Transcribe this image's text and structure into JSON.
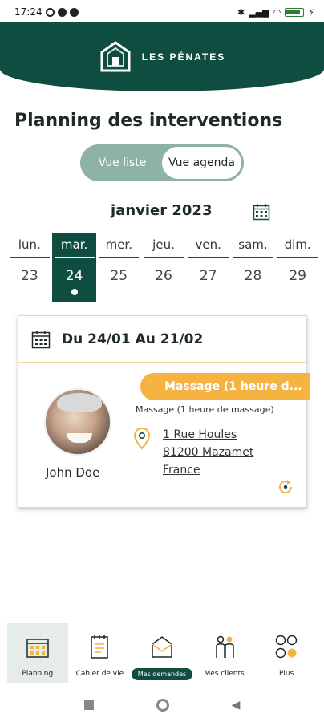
{
  "status_bar": {
    "time": "17:24"
  },
  "brand": {
    "name": "LES PÉNATES"
  },
  "page": {
    "title": "Planning des interventions"
  },
  "view_toggle": {
    "options": [
      {
        "label": "Vue liste"
      },
      {
        "label": "Vue agenda"
      }
    ],
    "selected": "Vue agenda"
  },
  "calendar": {
    "month": "janvier 2023",
    "days": [
      {
        "name": "lun.",
        "num": "23"
      },
      {
        "name": "mar.",
        "num": "24"
      },
      {
        "name": "mer.",
        "num": "25"
      },
      {
        "name": "jeu.",
        "num": "26"
      },
      {
        "name": "ven.",
        "num": "27"
      },
      {
        "name": "sam.",
        "num": "28"
      },
      {
        "name": "dim.",
        "num": "29"
      }
    ],
    "selected_day": "24"
  },
  "intervention": {
    "date_range": "Du 24/01 Au 21/02",
    "client_name": "John Doe",
    "service_title": "Massage (1 heure d...",
    "service_description": "Massage (1 heure de massage)",
    "address": {
      "line1": "1 Rue Houles",
      "line2": "81200 Mazamet",
      "line3": "France"
    },
    "colors": {
      "accent": "#f5b342",
      "brand": "#0f4d40"
    }
  },
  "bottom_nav": {
    "items": [
      {
        "label": "Planning",
        "icon": "calendar-icon"
      },
      {
        "label": "Cahier de vie",
        "icon": "notebook-icon"
      },
      {
        "label": "Mes demandes",
        "icon": "envelope-icon"
      },
      {
        "label": "Mes clients",
        "icon": "people-icon"
      },
      {
        "label": "Plus",
        "icon": "grid-dots-icon"
      }
    ],
    "active": "Planning"
  }
}
